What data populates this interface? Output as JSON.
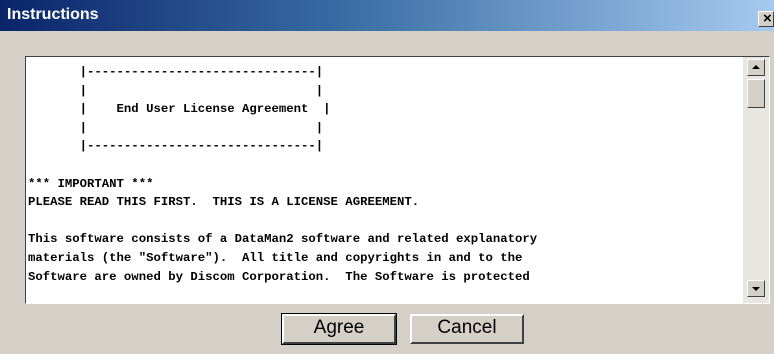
{
  "window": {
    "title": "Instructions",
    "close_label": "×"
  },
  "license_text": [
    "       |-------------------------------|",
    "       |                               |",
    "       |    End User License Agreement  |",
    "       |                               |",
    "       |-------------------------------|",
    "",
    "*** IMPORTANT ***",
    "PLEASE READ THIS FIRST.  THIS IS A LICENSE AGREEMENT.",
    "",
    "This software consists of a DataMan2 software and related explanatory",
    "materials (the \"Software\").  All title and copyrights in and to the",
    "Software are owned by Discom Corporation.  The Software is protected"
  ],
  "buttons": {
    "agree_label": "Agree",
    "cancel_label": "Cancel"
  }
}
